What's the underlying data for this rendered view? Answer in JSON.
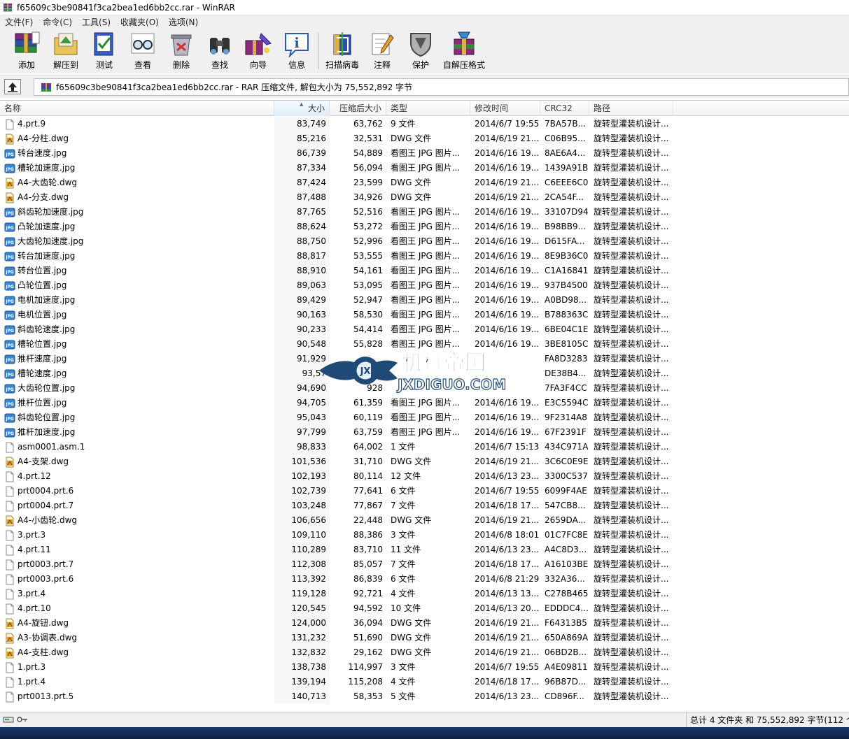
{
  "window": {
    "title": "f65609c3be90841f3ca2bea1ed6bb2cc.rar - WinRAR"
  },
  "menu": [
    "文件(F)",
    "命令(C)",
    "工具(S)",
    "收藏夹(O)",
    "选项(N)"
  ],
  "toolbar": [
    "添加",
    "解压到",
    "测试",
    "查看",
    "删除",
    "查找",
    "向导",
    "信息",
    "扫描病毒",
    "注释",
    "保护",
    "自解压格式"
  ],
  "address": {
    "text": "f65609c3be90841f3ca2bea1ed6bb2cc.rar - RAR 压缩文件, 解包大小为 75,552,892 字节"
  },
  "columns": {
    "name": "名称",
    "size": "大小",
    "packed": "压缩后大小",
    "type": "类型",
    "modified": "修改时间",
    "crc": "CRC32",
    "path": "路径"
  },
  "files": [
    {
      "name": "4.prt.9",
      "size": "83,749",
      "packed": "63,762",
      "type": "9 文件",
      "modified": "2014/6/7 19:55",
      "crc": "7BA57B...",
      "path": "旋转型灌装机设计...",
      "icon": "file"
    },
    {
      "name": "A4-分柱.dwg",
      "size": "85,216",
      "packed": "32,531",
      "type": "DWG 文件",
      "modified": "2014/6/19 21...",
      "crc": "C06B95...",
      "path": "旋转型灌装机设计...",
      "icon": "dwg"
    },
    {
      "name": "转台速度.jpg",
      "size": "86,739",
      "packed": "54,889",
      "type": "看图王 JPG 图片...",
      "modified": "2014/6/16 19...",
      "crc": "8AE6A4...",
      "path": "旋转型灌装机设计...",
      "icon": "jpg"
    },
    {
      "name": "槽轮加速度.jpg",
      "size": "87,334",
      "packed": "56,094",
      "type": "看图王 JPG 图片...",
      "modified": "2014/6/16 19...",
      "crc": "1439A91B",
      "path": "旋转型灌装机设计...",
      "icon": "jpg"
    },
    {
      "name": "A4-大齿轮.dwg",
      "size": "87,424",
      "packed": "23,599",
      "type": "DWG 文件",
      "modified": "2014/6/19 21...",
      "crc": "C6EEE6C0",
      "path": "旋转型灌装机设计...",
      "icon": "dwg"
    },
    {
      "name": "A4-分支.dwg",
      "size": "87,488",
      "packed": "34,926",
      "type": "DWG 文件",
      "modified": "2014/6/19 21...",
      "crc": "2CA54F...",
      "path": "旋转型灌装机设计...",
      "icon": "dwg"
    },
    {
      "name": "斜齿轮加速度.jpg",
      "size": "87,765",
      "packed": "52,516",
      "type": "看图王 JPG 图片...",
      "modified": "2014/6/16 19...",
      "crc": "33107D94",
      "path": "旋转型灌装机设计...",
      "icon": "jpg"
    },
    {
      "name": "凸轮加速度.jpg",
      "size": "88,624",
      "packed": "53,272",
      "type": "看图王 JPG 图片...",
      "modified": "2014/6/16 19...",
      "crc": "B98BB9...",
      "path": "旋转型灌装机设计...",
      "icon": "jpg"
    },
    {
      "name": "大齿轮加速度.jpg",
      "size": "88,750",
      "packed": "52,996",
      "type": "看图王 JPG 图片...",
      "modified": "2014/6/16 19...",
      "crc": "D615FA...",
      "path": "旋转型灌装机设计...",
      "icon": "jpg"
    },
    {
      "name": "转台加速度.jpg",
      "size": "88,817",
      "packed": "53,555",
      "type": "看图王 JPG 图片...",
      "modified": "2014/6/16 19...",
      "crc": "8E9B36C0",
      "path": "旋转型灌装机设计...",
      "icon": "jpg"
    },
    {
      "name": "转台位置.jpg",
      "size": "88,910",
      "packed": "54,161",
      "type": "看图王 JPG 图片...",
      "modified": "2014/6/16 19...",
      "crc": "C1A16841",
      "path": "旋转型灌装机设计...",
      "icon": "jpg"
    },
    {
      "name": "凸轮位置.jpg",
      "size": "89,063",
      "packed": "53,095",
      "type": "看图王 JPG 图片...",
      "modified": "2014/6/16 19...",
      "crc": "937B4500",
      "path": "旋转型灌装机设计...",
      "icon": "jpg"
    },
    {
      "name": "电机加速度.jpg",
      "size": "89,429",
      "packed": "52,947",
      "type": "看图王 JPG 图片...",
      "modified": "2014/6/16 19...",
      "crc": "A0BD98...",
      "path": "旋转型灌装机设计...",
      "icon": "jpg"
    },
    {
      "name": "电机位置.jpg",
      "size": "90,163",
      "packed": "58,530",
      "type": "看图王 JPG 图片...",
      "modified": "2014/6/16 19...",
      "crc": "B788363C",
      "path": "旋转型灌装机设计...",
      "icon": "jpg"
    },
    {
      "name": "斜齿轮速度.jpg",
      "size": "90,233",
      "packed": "54,414",
      "type": "看图王 JPG 图片...",
      "modified": "2014/6/16 19...",
      "crc": "6BE04C1E",
      "path": "旋转型灌装机设计...",
      "icon": "jpg"
    },
    {
      "name": "槽轮位置.jpg",
      "size": "90,548",
      "packed": "55,828",
      "type": "看图王 JPG 图片...",
      "modified": "2014/6/16 19...",
      "crc": "3BE8105C",
      "path": "旋转型灌装机设计...",
      "icon": "jpg"
    },
    {
      "name": "推杆速度.jpg",
      "size": "91,929",
      "packed": "",
      "type": "",
      "modified": "",
      "crc": "FA8D3283",
      "path": "旋转型灌装机设计...",
      "icon": "jpg"
    },
    {
      "name": "槽轮速度.jpg",
      "size": "93,57",
      "packed": "",
      "type": "",
      "modified": "",
      "crc": "DE38B4...",
      "path": "旋转型灌装机设计...",
      "icon": "jpg"
    },
    {
      "name": "大齿轮位置.jpg",
      "size": "94,690",
      "packed": "928",
      "type": "",
      "modified": "",
      "crc": "7FA3F4CC",
      "path": "旋转型灌装机设计...",
      "icon": "jpg"
    },
    {
      "name": "推杆位置.jpg",
      "size": "94,705",
      "packed": "61,359",
      "type": "看图王 JPG 图片...",
      "modified": "2014/6/16 19...",
      "crc": "E3C5594C",
      "path": "旋转型灌装机设计...",
      "icon": "jpg"
    },
    {
      "name": "斜齿轮位置.jpg",
      "size": "95,043",
      "packed": "60,119",
      "type": "看图王 JPG 图片...",
      "modified": "2014/6/16 19...",
      "crc": "9F2314A8",
      "path": "旋转型灌装机设计...",
      "icon": "jpg"
    },
    {
      "name": "推杆加速度.jpg",
      "size": "97,799",
      "packed": "63,759",
      "type": "看图王 JPG 图片...",
      "modified": "2014/6/16 19...",
      "crc": "67F2391F",
      "path": "旋转型灌装机设计...",
      "icon": "jpg"
    },
    {
      "name": "asm0001.asm.1",
      "size": "98,833",
      "packed": "64,002",
      "type": "1 文件",
      "modified": "2014/6/7 15:13",
      "crc": "434C971A",
      "path": "旋转型灌装机设计...",
      "icon": "file"
    },
    {
      "name": "A4-支架.dwg",
      "size": "101,536",
      "packed": "31,710",
      "type": "DWG 文件",
      "modified": "2014/6/19 21...",
      "crc": "3C6C0E9E",
      "path": "旋转型灌装机设计...",
      "icon": "dwg"
    },
    {
      "name": "4.prt.12",
      "size": "102,193",
      "packed": "80,114",
      "type": "12 文件",
      "modified": "2014/6/13 23...",
      "crc": "3300C537",
      "path": "旋转型灌装机设计...",
      "icon": "file"
    },
    {
      "name": "prt0004.prt.6",
      "size": "102,739",
      "packed": "77,641",
      "type": "6 文件",
      "modified": "2014/6/7 19:55",
      "crc": "6099F4AE",
      "path": "旋转型灌装机设计...",
      "icon": "file"
    },
    {
      "name": "prt0004.prt.7",
      "size": "103,248",
      "packed": "77,867",
      "type": "7 文件",
      "modified": "2014/6/18 17...",
      "crc": "547CB8...",
      "path": "旋转型灌装机设计...",
      "icon": "file"
    },
    {
      "name": "A4-小齿轮.dwg",
      "size": "106,656",
      "packed": "22,448",
      "type": "DWG 文件",
      "modified": "2014/6/19 21...",
      "crc": "2659DA...",
      "path": "旋转型灌装机设计...",
      "icon": "dwg"
    },
    {
      "name": "3.prt.3",
      "size": "109,110",
      "packed": "88,386",
      "type": "3 文件",
      "modified": "2014/6/8 18:01",
      "crc": "01C7FC8E",
      "path": "旋转型灌装机设计...",
      "icon": "file"
    },
    {
      "name": "4.prt.11",
      "size": "110,289",
      "packed": "83,710",
      "type": "11 文件",
      "modified": "2014/6/13 23...",
      "crc": "A4C8D3...",
      "path": "旋转型灌装机设计...",
      "icon": "file"
    },
    {
      "name": "prt0003.prt.7",
      "size": "112,308",
      "packed": "85,057",
      "type": "7 文件",
      "modified": "2014/6/18 17...",
      "crc": "A16103BE",
      "path": "旋转型灌装机设计...",
      "icon": "file"
    },
    {
      "name": "prt0003.prt.6",
      "size": "113,392",
      "packed": "86,839",
      "type": "6 文件",
      "modified": "2014/6/8 21:29",
      "crc": "332A36...",
      "path": "旋转型灌装机设计...",
      "icon": "file"
    },
    {
      "name": "3.prt.4",
      "size": "119,128",
      "packed": "92,721",
      "type": "4 文件",
      "modified": "2014/6/13 13...",
      "crc": "C278B465",
      "path": "旋转型灌装机设计...",
      "icon": "file"
    },
    {
      "name": "4.prt.10",
      "size": "120,545",
      "packed": "94,592",
      "type": "10 文件",
      "modified": "2014/6/13 20...",
      "crc": "EDDDC4...",
      "path": "旋转型灌装机设计...",
      "icon": "file"
    },
    {
      "name": "A4-旋钮.dwg",
      "size": "124,000",
      "packed": "36,094",
      "type": "DWG 文件",
      "modified": "2014/6/19 21...",
      "crc": "F64313B5",
      "path": "旋转型灌装机设计...",
      "icon": "dwg"
    },
    {
      "name": "A3-协调表.dwg",
      "size": "131,232",
      "packed": "51,690",
      "type": "DWG 文件",
      "modified": "2014/6/19 21...",
      "crc": "650A869A",
      "path": "旋转型灌装机设计...",
      "icon": "dwg"
    },
    {
      "name": "A4-支柱.dwg",
      "size": "132,832",
      "packed": "29,162",
      "type": "DWG 文件",
      "modified": "2014/6/19 21...",
      "crc": "06BD2B...",
      "path": "旋转型灌装机设计...",
      "icon": "dwg"
    },
    {
      "name": "1.prt.3",
      "size": "138,738",
      "packed": "114,997",
      "type": "3 文件",
      "modified": "2014/6/7 19:55",
      "crc": "A4E09811",
      "path": "旋转型灌装机设计...",
      "icon": "file"
    },
    {
      "name": "1.prt.4",
      "size": "139,194",
      "packed": "115,208",
      "type": "4 文件",
      "modified": "2014/6/18 17...",
      "crc": "96B87D...",
      "path": "旋转型灌装机设计...",
      "icon": "file"
    },
    {
      "name": "prt0013.prt.5",
      "size": "140,713",
      "packed": "58,353",
      "type": "5 文件",
      "modified": "2014/6/13 23...",
      "crc": "CD896F...",
      "path": "旋转型灌装机设计...",
      "icon": "file"
    }
  ],
  "watermark": {
    "cn": "机械帝国",
    "url": "JXDIGUO.COM",
    "badge": "JX"
  },
  "status": {
    "text": "总计 4 文件夹 和 75,552,892 字节(112 个"
  }
}
